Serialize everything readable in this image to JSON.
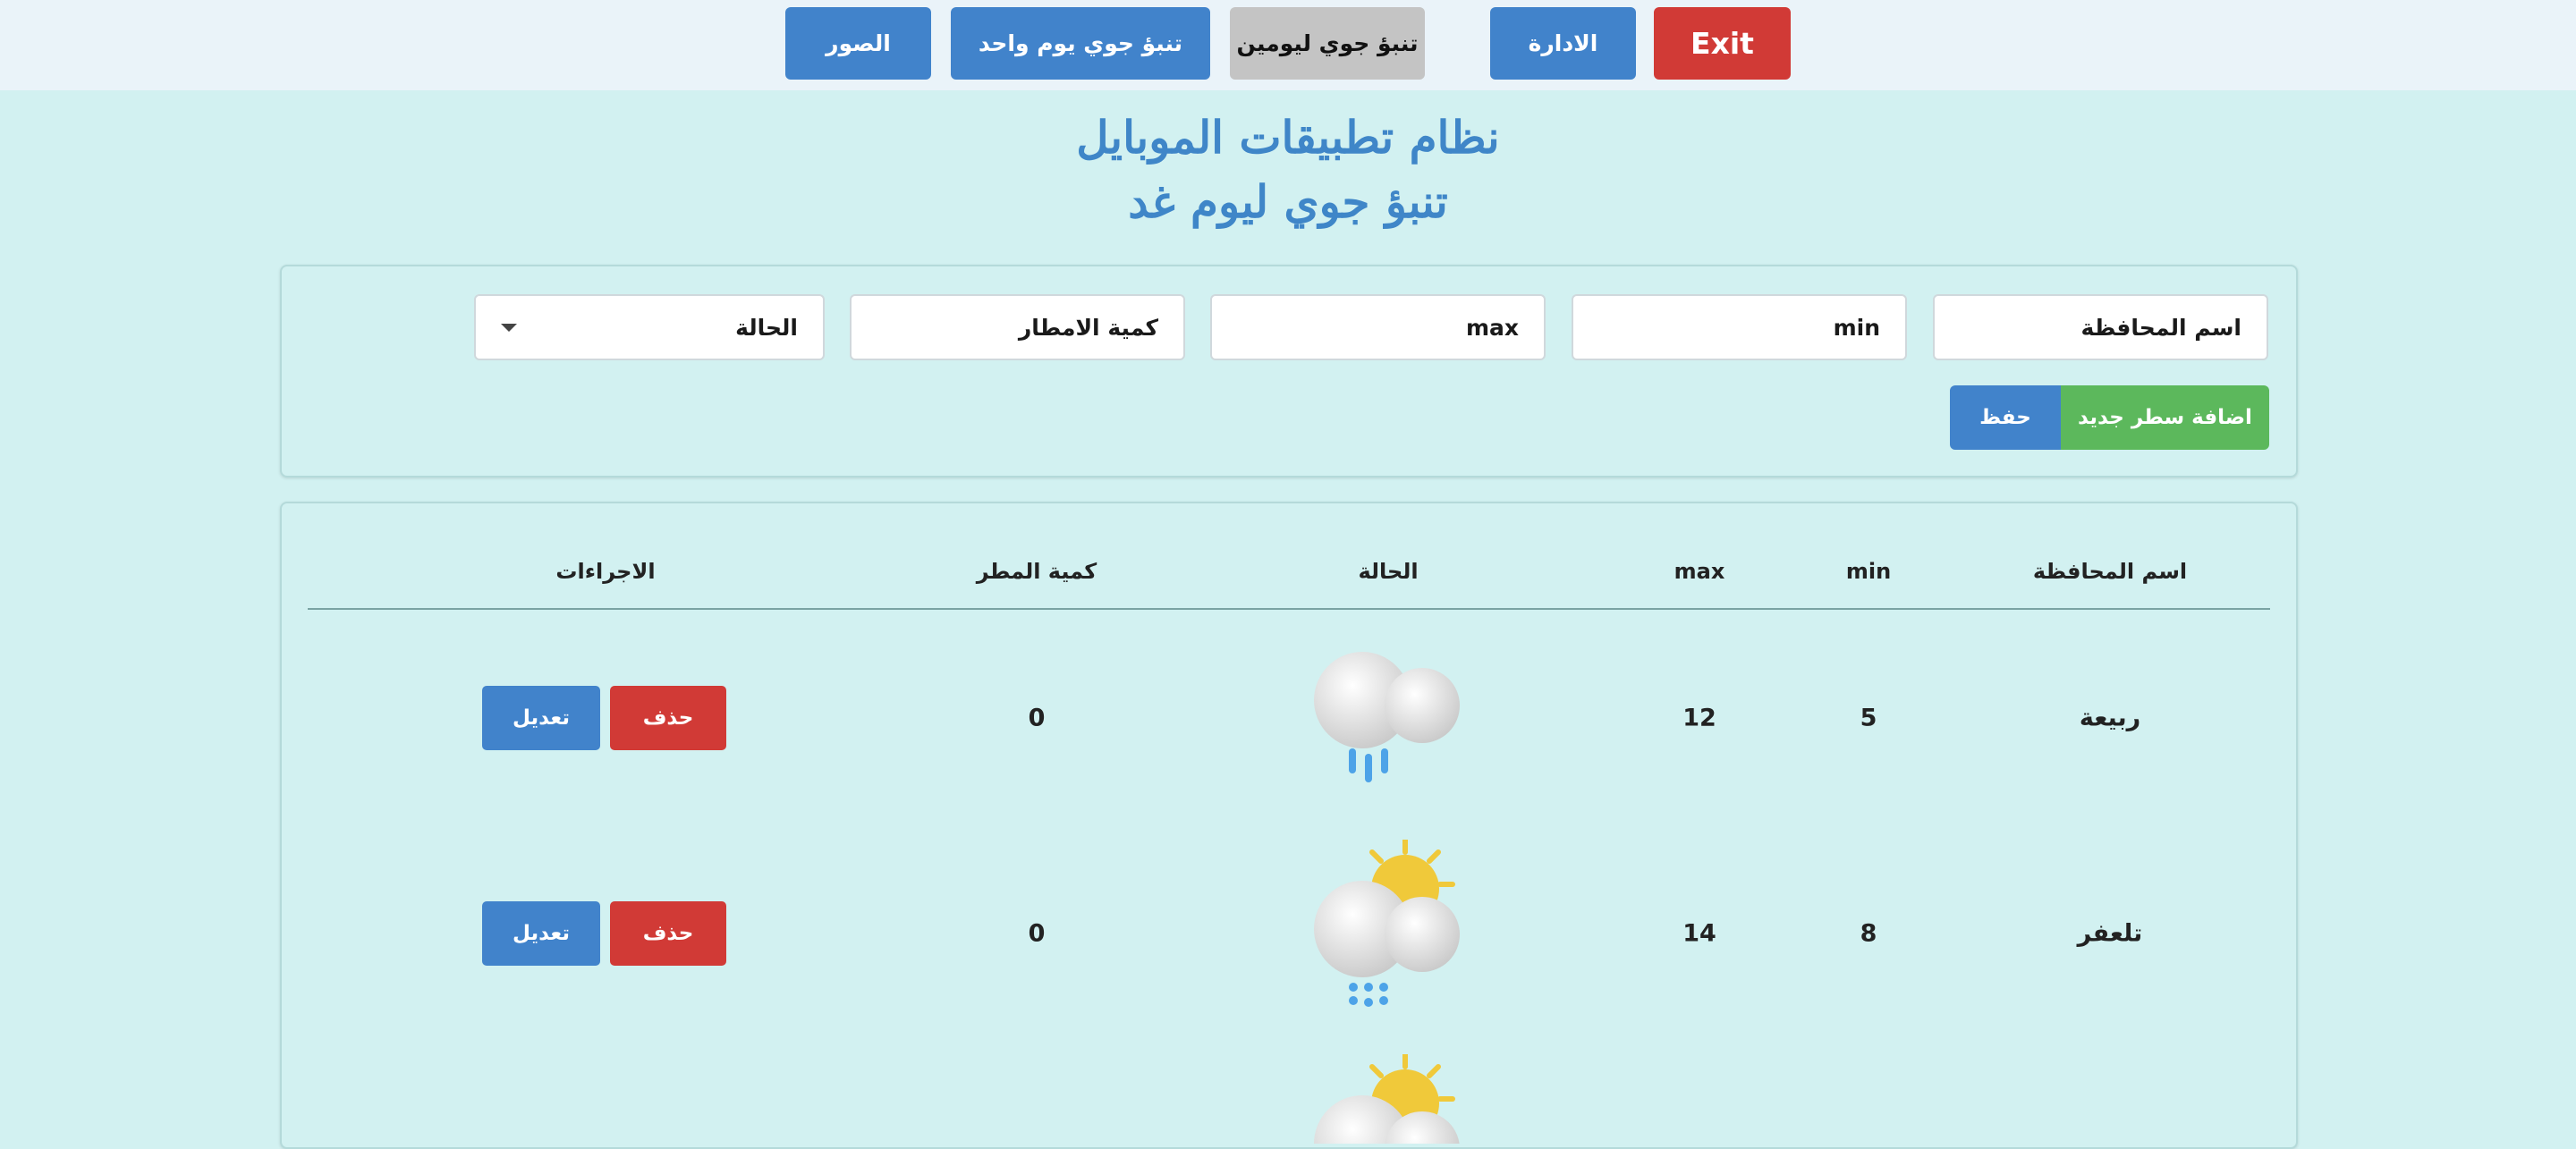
{
  "nav": {
    "photos": "الصور",
    "one_day": "تنبؤ جوي يوم واحد",
    "two_days": "تنبؤ جوي ليومين",
    "admin": "الادارة",
    "exit": "Exit"
  },
  "header": {
    "title": "نظام تطبيقات الموبايل",
    "subtitle": "تنبؤ جوي ليوم غد"
  },
  "form": {
    "governorate_placeholder": "اسم المحافظة",
    "min_placeholder": "min",
    "max_placeholder": "max",
    "rain_placeholder": "كمية الامطار",
    "status_selected": "الحالة",
    "add_row_label": "اضافة سطر جديد",
    "save_label": "حفظ"
  },
  "table": {
    "columns": [
      "اسم المحافظة",
      "min",
      "max",
      "الحالة",
      "كمية المطر",
      "الاجراءات"
    ],
    "rows": [
      {
        "governorate": "ربيعة",
        "min": "5",
        "max": "12",
        "status_icon": "cloud-rain-icon",
        "rain": "0",
        "delete_label": "حذف",
        "edit_label": "تعديل"
      },
      {
        "governorate": "تلعفر",
        "min": "8",
        "max": "14",
        "status_icon": "sun-cloud-drizzle-icon",
        "rain": "0",
        "delete_label": "حذف",
        "edit_label": "تعديل"
      },
      {
        "status_icon": "sun-cloud-icon"
      }
    ]
  },
  "colors": {
    "primary": "#4183cb",
    "danger": "#d13a36",
    "success": "#5cb85c",
    "background": "#d2f1f1",
    "title": "#3f86c8"
  }
}
